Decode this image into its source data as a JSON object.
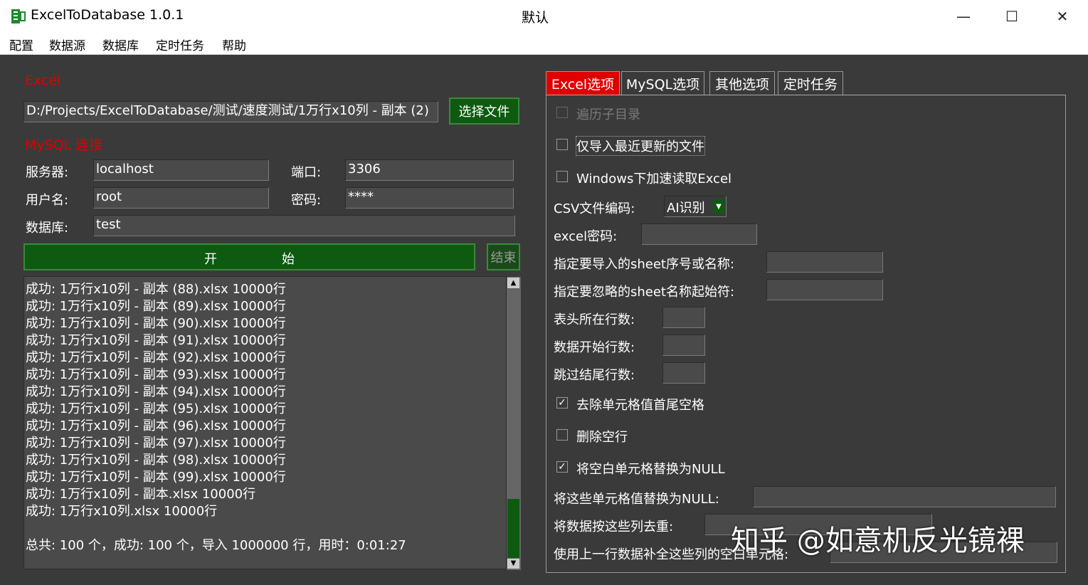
{
  "window": {
    "app_title": "ExcelToDatabase 1.0.1",
    "title": "默认",
    "minimize": "—",
    "maximize": "☐",
    "close": "✕"
  },
  "menu": [
    "配置",
    "数据源",
    "数据库",
    "定时任务",
    "帮助"
  ],
  "excel": {
    "section_label": "Excel",
    "file_path": "D:/Projects/ExcelToDatabase/测试/速度测试/1万行x10列 - 副本 (2)",
    "choose_file_label": "选择文件"
  },
  "mysql": {
    "section_label": "MySQL 连接",
    "server_label": "服务器:",
    "server_value": "localhost",
    "port_label": "端口:",
    "port_value": "3306",
    "user_label": "用户名:",
    "user_value": "root",
    "password_label": "密码:",
    "password_value": "****",
    "database_label": "数据库:",
    "database_value": "test"
  },
  "actions": {
    "start_left": "开",
    "start_right": "始",
    "end_label": "结束"
  },
  "log": {
    "lines": [
      "成功: 1万行x10列 - 副本 (88).xlsx 10000行",
      "成功: 1万行x10列 - 副本 (89).xlsx 10000行",
      "成功: 1万行x10列 - 副本 (90).xlsx 10000行",
      "成功: 1万行x10列 - 副本 (91).xlsx 10000行",
      "成功: 1万行x10列 - 副本 (92).xlsx 10000行",
      "成功: 1万行x10列 - 副本 (93).xlsx 10000行",
      "成功: 1万行x10列 - 副本 (94).xlsx 10000行",
      "成功: 1万行x10列 - 副本 (95).xlsx 10000行",
      "成功: 1万行x10列 - 副本 (96).xlsx 10000行",
      "成功: 1万行x10列 - 副本 (97).xlsx 10000行",
      "成功: 1万行x10列 - 副本 (98).xlsx 10000行",
      "成功: 1万行x10列 - 副本 (99).xlsx 10000行",
      "成功: 1万行x10列 - 副本.xlsx 10000行",
      "成功: 1万行x10列.xlsx 10000行"
    ],
    "summary": "总共: 100 个，成功: 100 个，导入 1000000 行，用时：0:01:27"
  },
  "tabs": [
    "Excel选项",
    "MySQL选项",
    "其他选项",
    "定时任务"
  ],
  "options": {
    "traverse_subdirs": "遍历子目录",
    "only_recent": "仅导入最近更新的文件",
    "windows_accel": "Windows下加速读取Excel",
    "csv_encoding_label": "CSV文件编码:",
    "csv_encoding_value": "AI识别",
    "excel_password_label": "excel密码:",
    "sheet_to_import_label": "指定要导入的sheet序号或名称:",
    "sheet_ignore_prefix_label": "指定要忽略的sheet名称起始符:",
    "header_row_label": "表头所在行数:",
    "data_start_row_label": "数据开始行数:",
    "skip_tail_rows_label": "跳过结尾行数:",
    "trim_spaces": "去除单元格值首尾空格",
    "delete_empty_rows": "删除空行",
    "blank_to_null": "将空白单元格替换为NULL",
    "values_to_null_label": "将这些单元格值替换为NULL:",
    "dedupe_label": "将数据按这些列去重:",
    "fill_from_prev_label": "使用上一行数据补全这些列的空白单元格:",
    "checks": {
      "traverse_subdirs": false,
      "only_recent": false,
      "windows_accel": false,
      "trim_spaces": true,
      "delete_empty_rows": false,
      "blank_to_null": true
    },
    "check_mark": "✓"
  },
  "watermark": "知乎 @如意机反光镜裸",
  "colors": {
    "accent_red": "#e00000",
    "button_green": "#0d5a10",
    "background": "#3a3a3a"
  },
  "scroll_position": 0.78
}
